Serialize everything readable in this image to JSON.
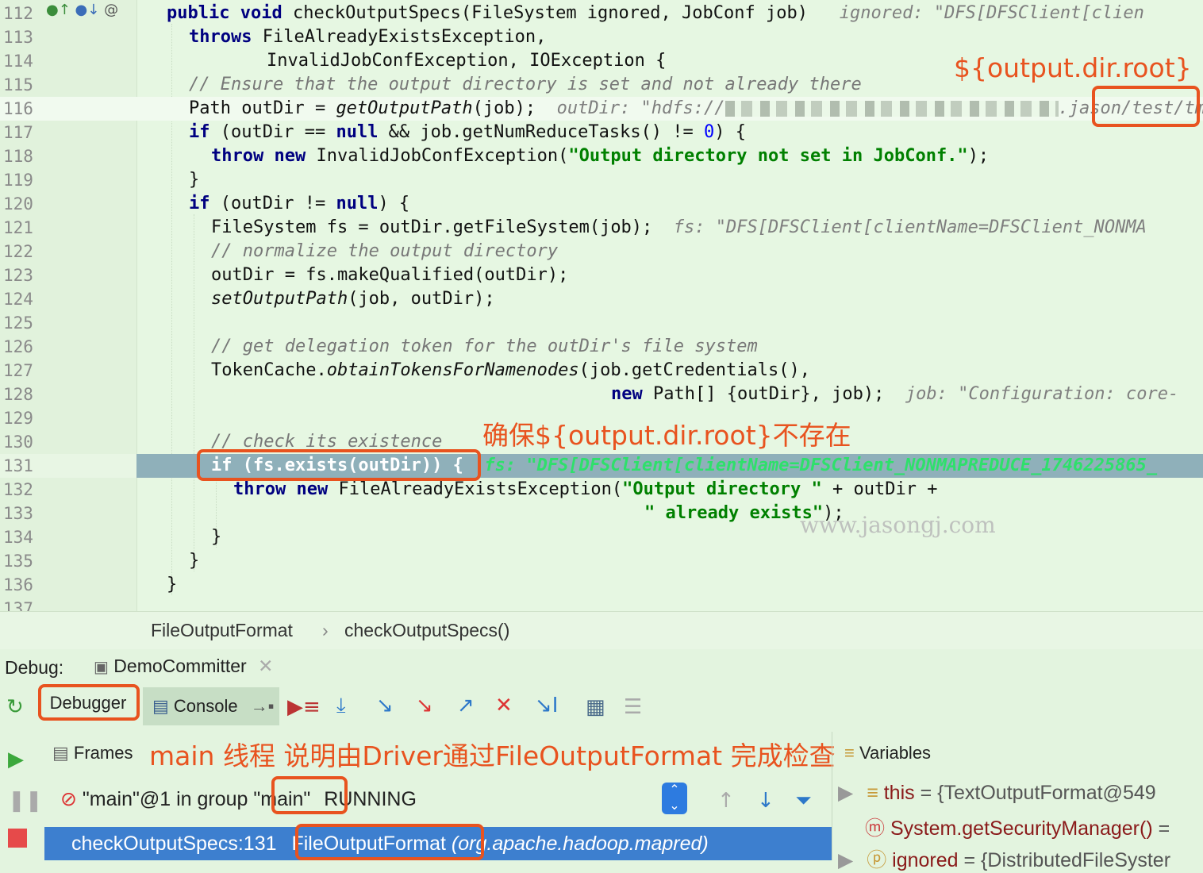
{
  "editor": {
    "lines": [
      {
        "no": "112"
      },
      {
        "no": "113"
      },
      {
        "no": "114"
      },
      {
        "no": "115"
      },
      {
        "no": "116"
      },
      {
        "no": "117"
      },
      {
        "no": "118"
      },
      {
        "no": "119"
      },
      {
        "no": "120"
      },
      {
        "no": "121"
      },
      {
        "no": "122"
      },
      {
        "no": "123"
      },
      {
        "no": "124"
      },
      {
        "no": "125"
      },
      {
        "no": "126"
      },
      {
        "no": "127"
      },
      {
        "no": "128"
      },
      {
        "no": "129"
      },
      {
        "no": "130"
      },
      {
        "no": "131"
      },
      {
        "no": "132"
      },
      {
        "no": "133"
      },
      {
        "no": "134"
      },
      {
        "no": "135"
      },
      {
        "no": "136"
      },
      {
        "no": "137"
      }
    ],
    "hints": {
      "l112": "ignored: \"DFS[DFSClient[clien",
      "l116_pre": "outDir: \"hdfs://",
      "l116_post": ".jason/",
      "l116_box": "test/tmp\"",
      "l121": "fs: \"DFS[DFSClient[clientName=DFSClient_NONMA",
      "l128": "job: \"Configuration: core-",
      "l131": "fs: \"DFS[DFSClient[clientName=DFSClient_NONMAPREDUCE_1746225865_"
    },
    "watermark": "www.jasongj.com"
  },
  "annotations": {
    "output_root": "${output.dir.root}",
    "ensure_absent": "确保${output.dir.root}不存在",
    "main_thread": "main 线程 说明由Driver通过FileOutputFormat 完成检查"
  },
  "breadcrumb": {
    "class_name": "FileOutputFormat",
    "separator": "›",
    "method_name": "checkOutputSpecs()"
  },
  "debug": {
    "label": "Debug:",
    "session_tab": "DemoCommitter",
    "debugger_tab": "Debugger",
    "console_tab": "Console",
    "frames_label": "Frames",
    "variables_label": "Variables",
    "thread": {
      "name": "\"main\"@1 in group ",
      "group": "\"main\"",
      "status": "RUNNING"
    },
    "frame": {
      "location": "checkOutputSpecs:131",
      "class": "FileOutputFormat",
      "package": "(org.apache.hadoop.mapred)"
    },
    "variables": [
      {
        "name": "this",
        "value": "= {TextOutputFormat@549"
      },
      {
        "name": "System.getSecurityManager()",
        "value": "="
      },
      {
        "name": "ignored",
        "value": "= {DistributedFileSyster"
      }
    ]
  }
}
